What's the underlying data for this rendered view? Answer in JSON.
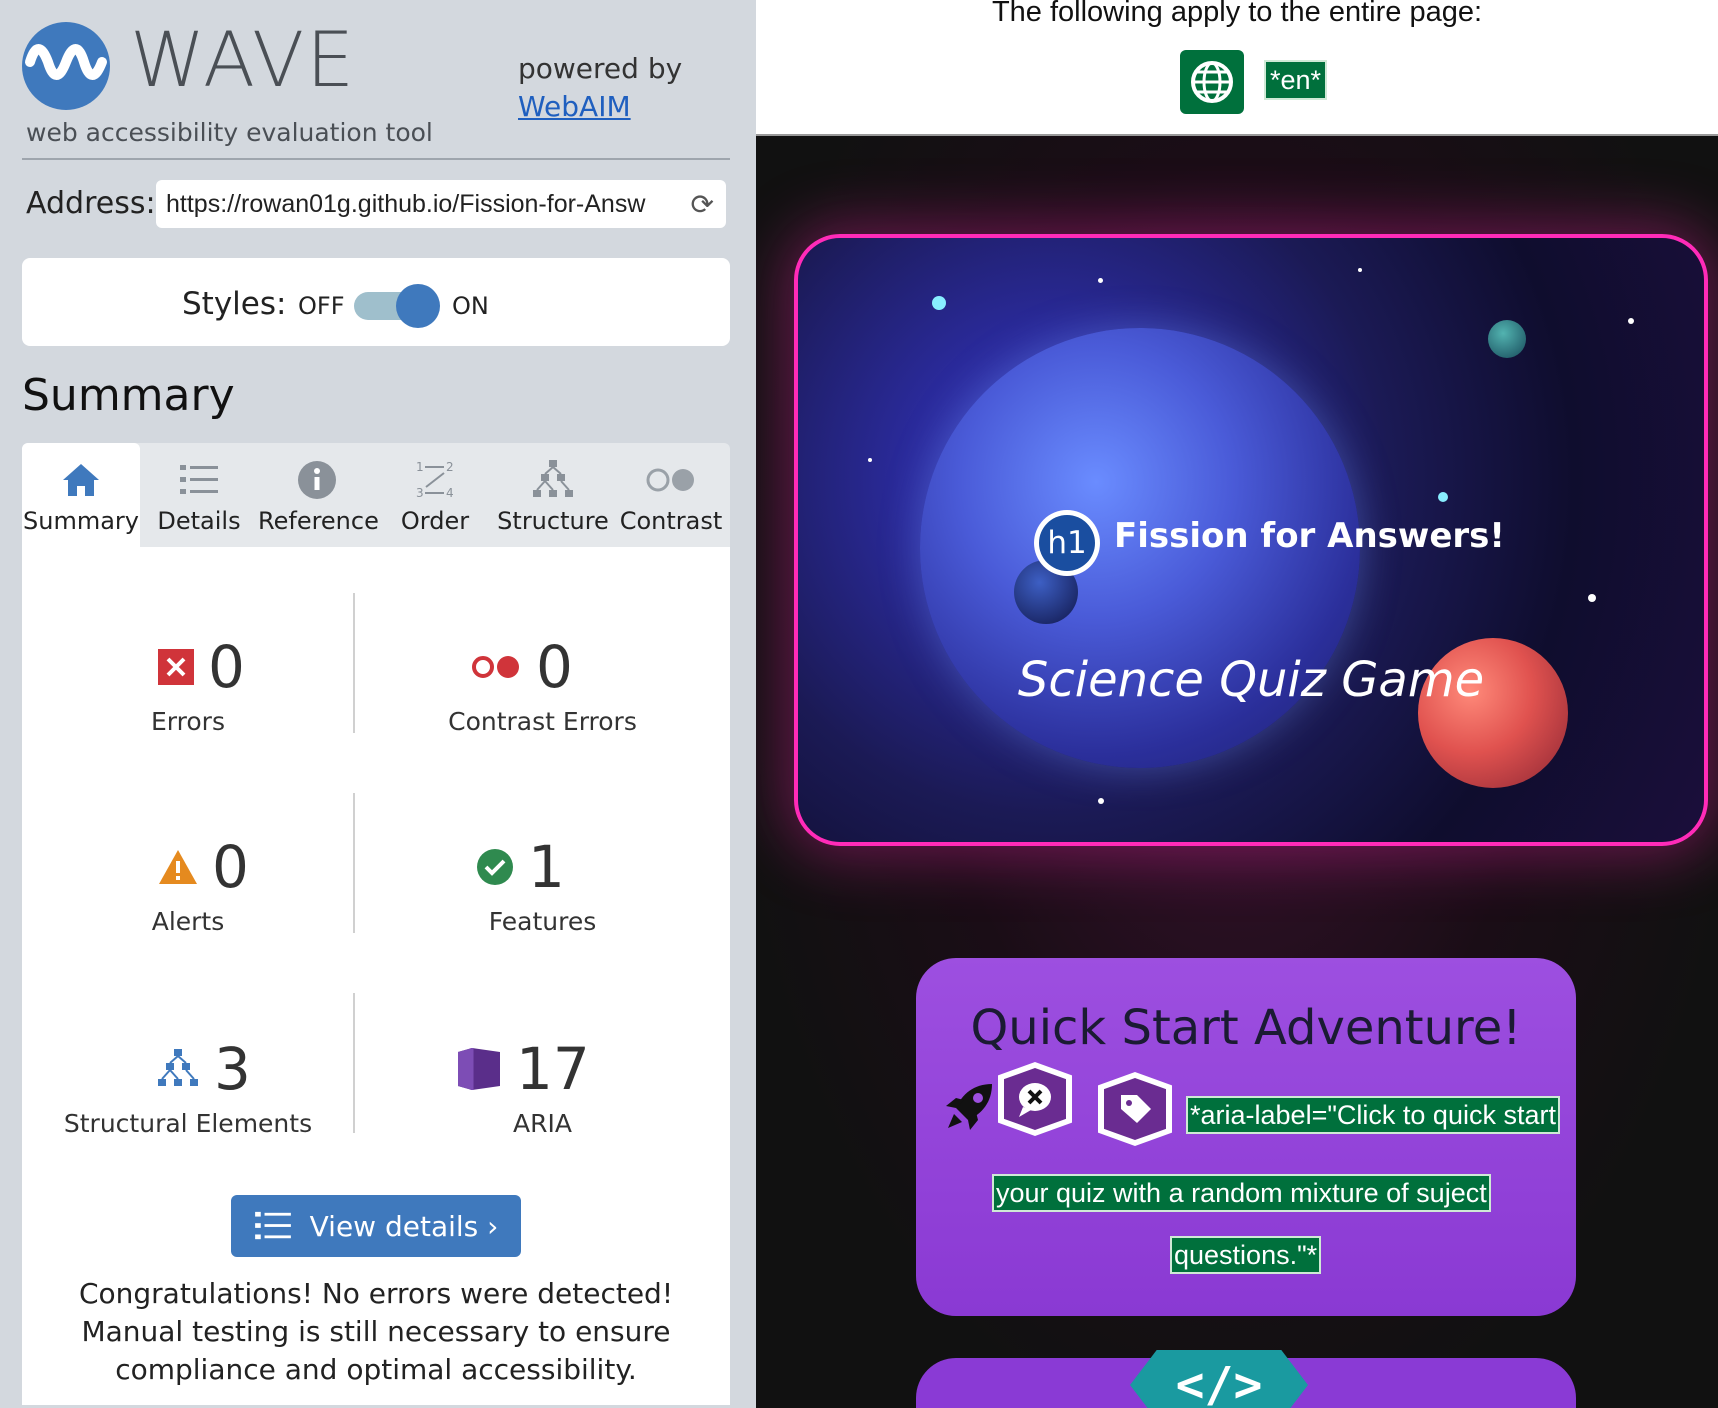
{
  "wave": {
    "logo_text": "WAVE",
    "logo_subtitle": "web accessibility evaluation tool",
    "powered_by": "powered by",
    "webaim_link": "WebAIM",
    "address_label": "Address:",
    "address_value": "https://rowan01g.github.io/Fission-for-Answ",
    "styles_label": "Styles:",
    "styles_off": "OFF",
    "styles_on": "ON",
    "styles_state": "on",
    "summary_heading": "Summary",
    "tabs": [
      {
        "label": "Summary",
        "icon": "home-icon",
        "active": true
      },
      {
        "label": "Details",
        "icon": "list-icon"
      },
      {
        "label": "Reference",
        "icon": "info-icon"
      },
      {
        "label": "Order",
        "icon": "order-icon"
      },
      {
        "label": "Structure",
        "icon": "structure-icon"
      },
      {
        "label": "Contrast",
        "icon": "contrast-icon"
      }
    ],
    "stats": {
      "errors": {
        "count": "0",
        "label": "Errors"
      },
      "contrast_errors": {
        "count": "0",
        "label": "Contrast Errors"
      },
      "alerts": {
        "count": "0",
        "label": "Alerts"
      },
      "features": {
        "count": "1",
        "label": "Features"
      },
      "structural": {
        "count": "3",
        "label": "Structural Elements"
      },
      "aria": {
        "count": "17",
        "label": "ARIA"
      }
    },
    "view_details": "View details ›",
    "congrats": "Congratulations! No errors were detected! Manual testing is still necessary to ensure compliance and optimal accessibility."
  },
  "page": {
    "apply_text": "The following apply to the entire page:",
    "lang_badge": "*en*",
    "hero_badge": "h1",
    "hero_title": "Fission for Answers!",
    "hero_subtitle": "Science Quiz Game",
    "quick_title": "Quick Start Adventure!",
    "aria_lines": [
      "*aria-label=\"Click to quick start",
      "your quiz with a random mixture of suject",
      "questions.\"*"
    ],
    "code_badge": "</>"
  },
  "colors": {
    "wave_blue": "#3f79bd",
    "wave_green": "#00703c",
    "hero_border": "#ff2bb8",
    "card_purple": "#9d4fe0"
  }
}
